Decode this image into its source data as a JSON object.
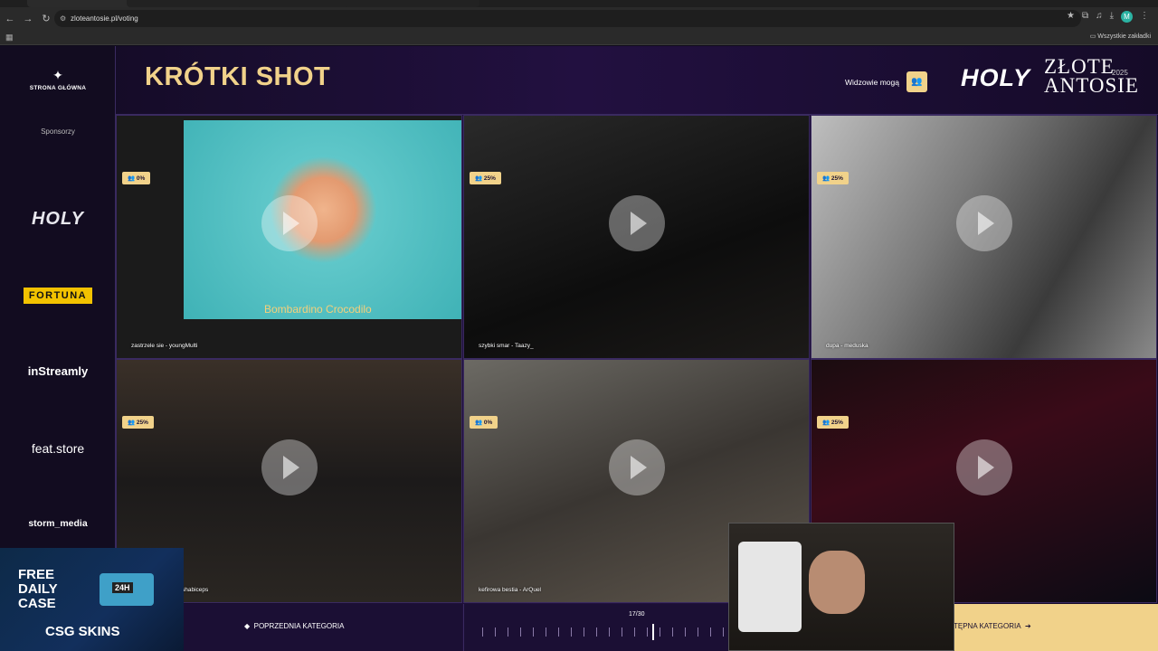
{
  "browser": {
    "url": "zloteantosie.pl/voting",
    "bookmarks_all": "Wszystkie zakładki",
    "profile_initial": "M"
  },
  "sidebar": {
    "home_label": "STRONA GŁÓWNA",
    "sponsors_label": "Sponsorzy",
    "sponsors": [
      "HOLY",
      "FORTUNA",
      "inStreamly",
      "feat.store",
      "storm_media"
    ]
  },
  "header": {
    "title": "KRÓTKI SHOT",
    "viewers_label": "Widzowie mogą",
    "logo_holy": "HOLY",
    "logo_zlote": "ZŁOTE",
    "logo_antosie": "ANTOSIE",
    "logo_year": "2025"
  },
  "tiles": [
    {
      "percent": "0%",
      "caption": "zastrzele sie - youngMulti",
      "subtitle": "Bombardino Crocodilo"
    },
    {
      "percent": "25%",
      "caption": "szybki smar - Taazy_"
    },
    {
      "percent": "25%",
      "caption": "dupa - meduska"
    },
    {
      "percent": "25%",
      "caption": "shabiceps"
    },
    {
      "percent": "0%",
      "caption": "kefirowa bestia - ArQuel"
    },
    {
      "percent": "25%",
      "caption": ""
    }
  ],
  "bottom": {
    "prev_label": "POPRZEDNIA KATEGORIA",
    "progress": "17/30",
    "next_label": "TĘPNA KATEGORIA"
  },
  "ad": {
    "line1": "FREE",
    "line2": "DAILY",
    "line3": "CASE",
    "brand": "CSG SKINS",
    "timer": "24H"
  }
}
